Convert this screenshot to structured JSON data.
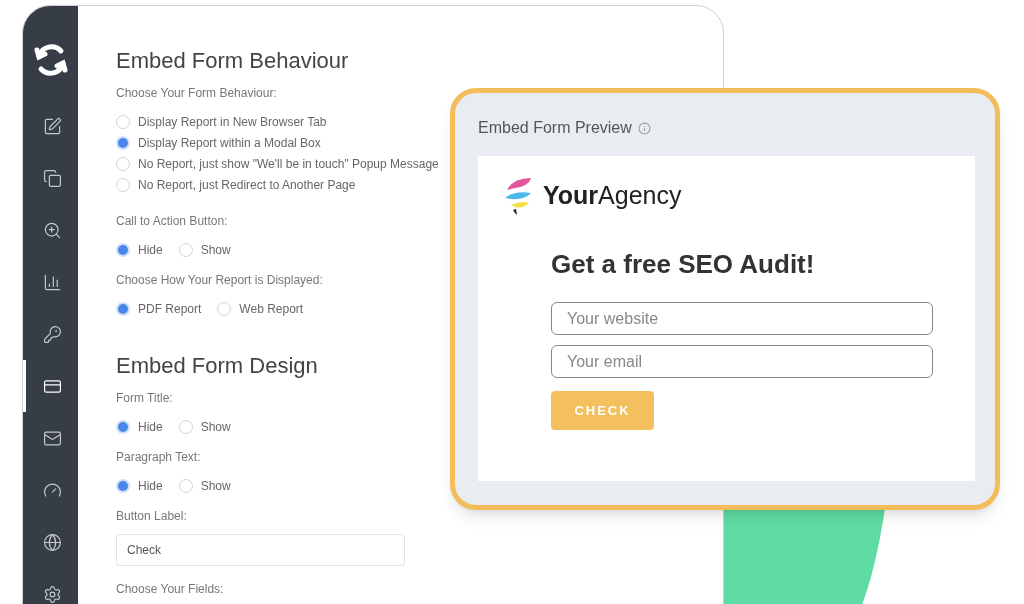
{
  "sidebar": {
    "items": [
      {
        "selected": false
      },
      {
        "selected": false
      },
      {
        "selected": false
      },
      {
        "selected": false
      },
      {
        "selected": false
      },
      {
        "selected": true
      },
      {
        "selected": false
      },
      {
        "selected": false
      },
      {
        "selected": false
      },
      {
        "selected": false
      }
    ]
  },
  "sections": [
    {
      "title": "Embed Form Behaviour",
      "groups": [
        {
          "label": "Choose Your Form Behaviour:",
          "kind": "radio_list",
          "options": [
            {
              "label": "Display Report in New Browser Tab",
              "selected": false
            },
            {
              "label": "Display Report within a Modal Box",
              "selected": true
            },
            {
              "label": "No Report, just show \"We'll be in touch\" Popup Message",
              "selected": false
            },
            {
              "label": "No Report, just Redirect to Another Page",
              "selected": false
            }
          ]
        },
        {
          "label": "Call to Action Button:",
          "kind": "radio_inline",
          "options": [
            {
              "label": "Hide",
              "selected": true
            },
            {
              "label": "Show",
              "selected": false
            }
          ]
        },
        {
          "label": "Choose How Your Report is Displayed:",
          "kind": "radio_inline",
          "options": [
            {
              "label": "PDF Report",
              "selected": true
            },
            {
              "label": "Web Report",
              "selected": false
            }
          ]
        }
      ]
    },
    {
      "title": "Embed Form Design",
      "groups": [
        {
          "label": "Form Title:",
          "kind": "radio_inline",
          "options": [
            {
              "label": "Hide",
              "selected": true
            },
            {
              "label": "Show",
              "selected": false
            }
          ]
        },
        {
          "label": "Paragraph Text:",
          "kind": "radio_inline",
          "options": [
            {
              "label": "Hide",
              "selected": true
            },
            {
              "label": "Show",
              "selected": false
            }
          ]
        },
        {
          "label": "Button Label:",
          "kind": "text_field",
          "value": "Check"
        },
        {
          "label": "Choose Your Fields:",
          "kind": "label"
        }
      ]
    }
  ],
  "preview": {
    "title": "Embed Form Preview",
    "brand": "**Your**Agency",
    "headline": "Get a free SEO Audit!",
    "fields": [
      {
        "placeholder": "Your website"
      },
      {
        "placeholder": "Your email"
      }
    ],
    "button": "CHECK"
  }
}
